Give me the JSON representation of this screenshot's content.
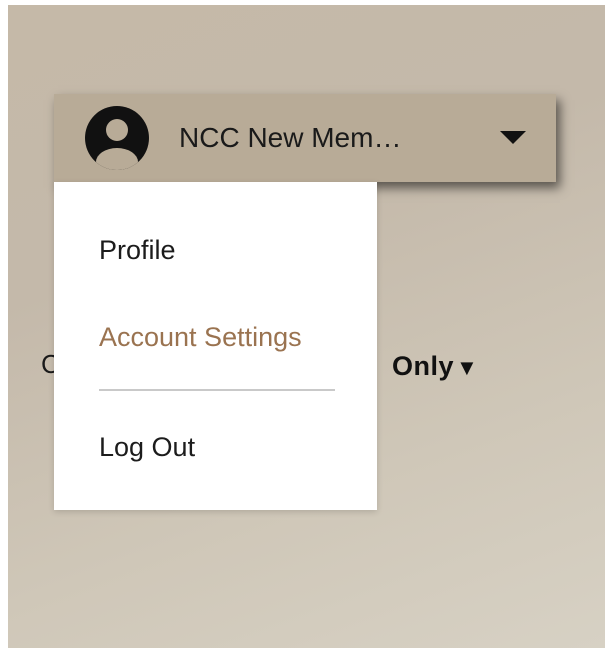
{
  "user_menu": {
    "name": "NCC New Mem…",
    "avatar_icon": "user-avatar-icon",
    "caret_icon": "caret-down-icon"
  },
  "dropdown": {
    "items": [
      {
        "label": "Profile"
      },
      {
        "label": "Account Settings",
        "color": "#9a7350"
      },
      {
        "label": "Log Out"
      }
    ]
  },
  "background": {
    "left_fragment": "C",
    "right_fragment": "Only",
    "right_caret": "▼"
  },
  "colors": {
    "button_bg": "#b8ab97",
    "page_bg": "#c6bcac",
    "accent_link": "#9a7350"
  }
}
